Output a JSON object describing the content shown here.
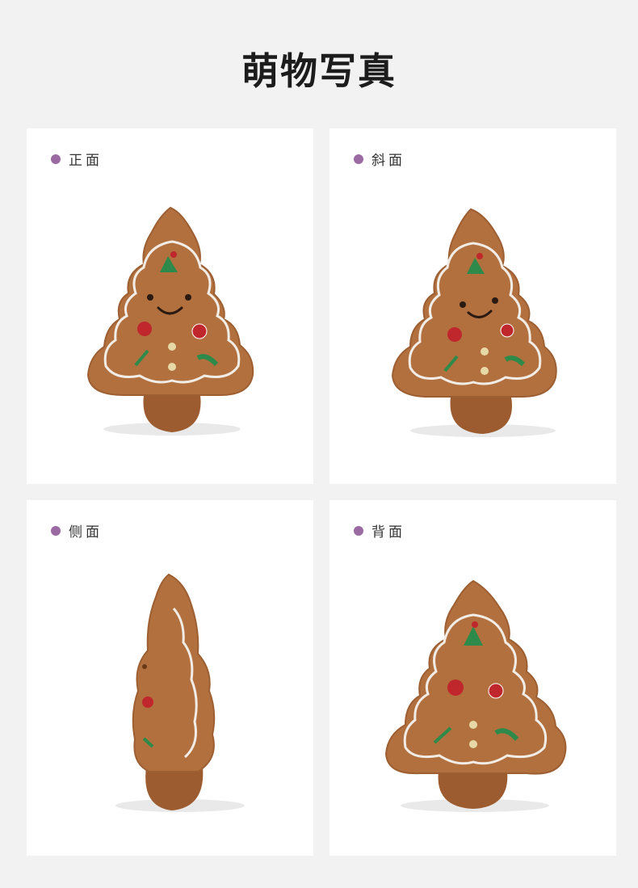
{
  "header": {
    "title": "萌物写真"
  },
  "colors": {
    "background": "#f2f2f3",
    "dot": "#9b6aa3",
    "plush_brown": "#b2703f",
    "plush_dark": "#8a5128",
    "trim_white": "#f1ede6",
    "ornament_red": "#c0272d",
    "ornament_green": "#2e8a4a"
  },
  "cards": [
    {
      "label": "正面",
      "image": "gingerbread-tree-plush-front"
    },
    {
      "label": "斜面",
      "image": "gingerbread-tree-plush-angled"
    },
    {
      "label": "侧面",
      "image": "gingerbread-tree-plush-side"
    },
    {
      "label": "背面",
      "image": "gingerbread-tree-plush-back"
    }
  ]
}
